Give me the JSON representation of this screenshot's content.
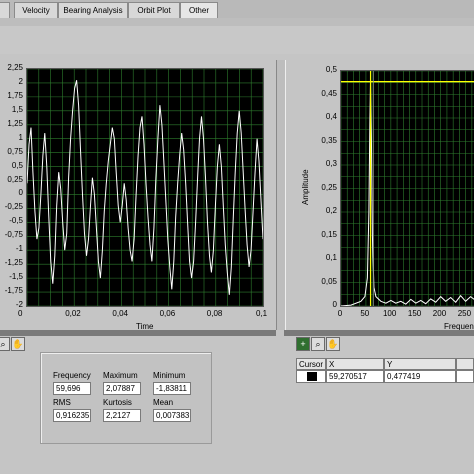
{
  "tabs": [
    {
      "label": "Velocity",
      "active": false
    },
    {
      "label": "Bearing Analysis",
      "active": false
    },
    {
      "label": "Orbit Plot",
      "active": false
    },
    {
      "label": "Other",
      "active": true
    }
  ],
  "time_plot": {
    "xlabel": "Time",
    "yticks": [
      "2,25",
      "2",
      "1,75",
      "1,5",
      "1,25",
      "1",
      "0,75",
      "0,5",
      "0,25",
      "0",
      "-0,25",
      "-0,5",
      "-0,75",
      "-1",
      "-1,25",
      "-1,5",
      "-1,75",
      "-2"
    ],
    "xticks": [
      "0",
      "0,02",
      "0,04",
      "0,06",
      "0,08",
      "0,1"
    ],
    "trace_color": "#ffffff",
    "grid_color": "#2e7d2e",
    "samples": [
      0.2,
      0.9,
      1.2,
      0.4,
      -0.3,
      -0.8,
      -0.6,
      0.0,
      0.7,
      1.1,
      0.5,
      -0.4,
      -1.2,
      -1.6,
      -1.1,
      -0.2,
      0.4,
      0.1,
      -0.5,
      -1.0,
      -0.7,
      0.3,
      1.0,
      1.5,
      1.9,
      2.05,
      1.6,
      0.8,
      0.0,
      -0.7,
      -1.1,
      -0.8,
      -0.2,
      0.3,
      0.0,
      -0.6,
      -1.2,
      -1.5,
      -1.0,
      -0.3,
      0.2,
      0.6,
      0.9,
      1.2,
      1.0,
      0.4,
      -0.2,
      -0.5,
      -0.2,
      0.2,
      -0.1,
      -0.6,
      -1.0,
      -1.2,
      -0.8,
      0.0,
      0.7,
      1.2,
      1.4,
      0.9,
      0.2,
      -0.4,
      -0.9,
      -1.2,
      -0.6,
      0.3,
      1.0,
      1.6,
      1.25,
      0.6,
      -0.1,
      -0.8,
      -1.3,
      -1.7,
      -1.2,
      -0.4,
      0.2,
      0.7,
      1.1,
      0.8,
      0.2,
      -0.5,
      -1.2,
      -1.5,
      -1.2,
      -0.5,
      0.3,
      1.0,
      1.4,
      1.0,
      0.3,
      -0.5,
      -1.1,
      -1.4,
      -1.0,
      -0.2,
      0.5,
      0.9,
      0.5,
      -0.2,
      -0.9,
      -1.4,
      -1.8,
      -1.3,
      -0.4,
      0.4,
      1.1,
      1.5,
      1.1,
      0.4,
      -0.3,
      -0.9,
      -1.3,
      -1.0,
      -0.3,
      0.4,
      1.0,
      0.6,
      -0.1,
      -0.8
    ],
    "ymin": -2,
    "ymax": 2.25
  },
  "freq_plot": {
    "ylabel": "Amplitude",
    "xlabel": "Frequen",
    "yticks": [
      "0,5",
      "0,45",
      "0,4",
      "0,35",
      "0,3",
      "0,25",
      "0,2",
      "0,15",
      "0,1",
      "0,05",
      "0"
    ],
    "xticks": [
      "0",
      "50",
      "100",
      "150",
      "200",
      "250"
    ],
    "peak_x": 59.270517,
    "peak_y": 0.477419,
    "xmax": 280,
    "ymax": 0.5,
    "trace_color": "#ffffff",
    "cursor_color": "#ffff00",
    "spectrum": [
      [
        0,
        0
      ],
      [
        20,
        0.002
      ],
      [
        40,
        0.01
      ],
      [
        48,
        0.02
      ],
      [
        53,
        0.06
      ],
      [
        56,
        0.2
      ],
      [
        58,
        0.4
      ],
      [
        59.27,
        0.477
      ],
      [
        61,
        0.36
      ],
      [
        63,
        0.15
      ],
      [
        66,
        0.04
      ],
      [
        70,
        0.02
      ],
      [
        80,
        0.01
      ],
      [
        90,
        0.006
      ],
      [
        100,
        0.012
      ],
      [
        110,
        0.006
      ],
      [
        120,
        0.01
      ],
      [
        130,
        0.004
      ],
      [
        140,
        0.014
      ],
      [
        150,
        0.006
      ],
      [
        160,
        0.012
      ],
      [
        170,
        0.005
      ],
      [
        180,
        0.015
      ],
      [
        190,
        0.008
      ],
      [
        200,
        0.02
      ],
      [
        210,
        0.01
      ],
      [
        220,
        0.018
      ],
      [
        230,
        0.008
      ],
      [
        240,
        0.022
      ],
      [
        250,
        0.01
      ],
      [
        260,
        0.02
      ],
      [
        270,
        0.012
      ],
      [
        280,
        0.016
      ]
    ]
  },
  "stats": {
    "frequency_label": "Frequency",
    "frequency_value": "59,696",
    "maximum_label": "Maximum",
    "maximum_value": "2,07887",
    "minimum_label": "Minimum",
    "minimum_value": "-1,83811",
    "rms_label": "RMS",
    "rms_value": "0,916235",
    "kurtosis_label": "Kurtosis",
    "kurtosis_value": "2,2127",
    "mean_label": "Mean",
    "mean_value": "0,007383"
  },
  "cursor": {
    "header_cursor": "Cursor",
    "header_x": "X",
    "header_y": "Y",
    "x_value": "59,270517",
    "y_value": "0,477419"
  }
}
